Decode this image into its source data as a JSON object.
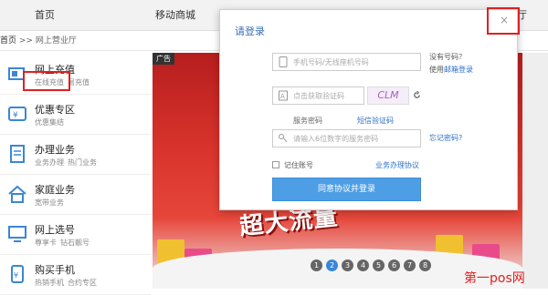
{
  "topnav": {
    "items": [
      "首页",
      "移动商城",
      "厅"
    ]
  },
  "breadcrumb": {
    "home": "首页",
    "sep": " >> ",
    "current": "网上营业厅"
  },
  "sidebar": {
    "items": [
      {
        "title": "网上充值",
        "subs": [
          "在线充值",
          "易充值"
        ],
        "icon": "phone-charge-icon"
      },
      {
        "title": "优惠专区",
        "subs": [
          "优惠集结"
        ],
        "icon": "discount-icon"
      },
      {
        "title": "办理业务",
        "subs": [
          "业务办理",
          "热门业务"
        ],
        "icon": "document-icon"
      },
      {
        "title": "家庭业务",
        "subs": [
          "宽带业务"
        ],
        "icon": "home-icon"
      },
      {
        "title": "网上选号",
        "subs": [
          "尊享卡",
          "钻石靓号"
        ],
        "icon": "monitor-icon"
      },
      {
        "title": "购买手机",
        "subs": [
          "热销手机",
          "合约专区"
        ],
        "icon": "mobile-purchase-icon"
      }
    ]
  },
  "banner": {
    "ad_tag": "广告",
    "slogan": "超大流量"
  },
  "pager": {
    "pages": [
      "1",
      "2",
      "3",
      "4",
      "5",
      "6",
      "7",
      "8"
    ],
    "active": "2"
  },
  "login": {
    "title": "请登录",
    "close": "×",
    "phone_placeholder": "手机号码/无线座机号码",
    "no_account": "没有号码？",
    "use_email": "使用",
    "email_login": "邮箱登录",
    "captcha_placeholder": "点击获取验证码",
    "captcha_image": "CLM",
    "tab_service_password": "服务密码",
    "tab_sms_code": "短信验证码",
    "password_placeholder": "请输入6位数字的服务密码",
    "forgot_password": "忘记密码?",
    "remember_me": "记住账号",
    "service_agreement": "业务办理协议",
    "submit": "同意协议并登录"
  },
  "watermark": "第一pos网"
}
